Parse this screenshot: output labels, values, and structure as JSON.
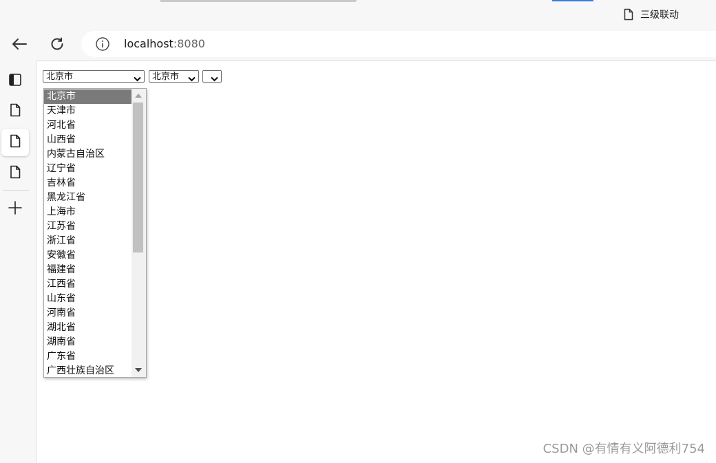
{
  "tab": {
    "title": "三级联动",
    "icon": "document-icon"
  },
  "nav": {
    "back_icon": "back-arrow-icon",
    "reload_icon": "reload-icon",
    "info_icon": "info-icon",
    "url_host": "localhost",
    "url_port": ":8080"
  },
  "sidebar": {
    "icons": [
      "sidebar-panel-icon",
      "document-icon",
      "document-icon",
      "document-icon",
      "plus-icon"
    ]
  },
  "selects": {
    "province": "北京市",
    "city": "北京市",
    "district": ""
  },
  "province_options": [
    "北京市",
    "天津市",
    "河北省",
    "山西省",
    "内蒙古自治区",
    "辽宁省",
    "吉林省",
    "黑龙江省",
    "上海市",
    "江苏省",
    "浙江省",
    "安徽省",
    "福建省",
    "江西省",
    "山东省",
    "河南省",
    "湖北省",
    "湖南省",
    "广东省",
    "广西壮族自治区"
  ],
  "watermark": "CSDN @有情有义阿德利754",
  "colors": {
    "selected_option_bg": "#7a7a7a",
    "tab_accent": "#3a7be0"
  }
}
